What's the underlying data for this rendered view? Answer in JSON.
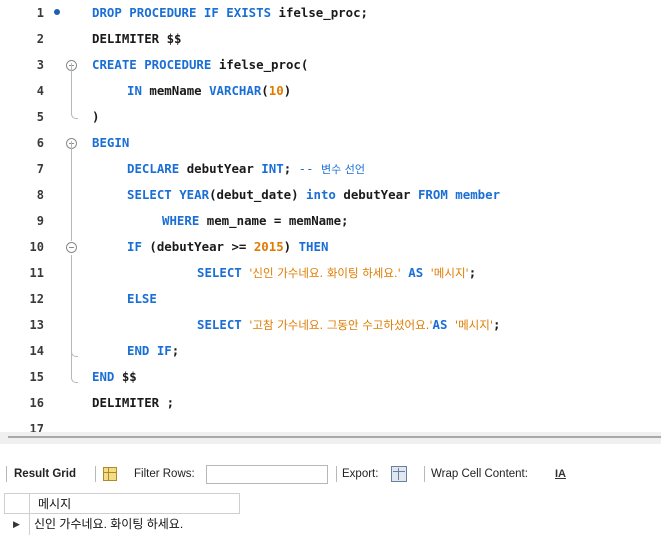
{
  "editor": {
    "lines": [
      {
        "n": "1",
        "tokens": [
          {
            "t": "DROP PROCEDURE IF EXISTS ",
            "c": "kw"
          },
          {
            "t": "ifelse_proc;",
            "c": "id"
          }
        ]
      },
      {
        "n": "2",
        "tokens": [
          {
            "t": "DELIMITER $$",
            "c": "id"
          }
        ]
      },
      {
        "n": "3",
        "tokens": [
          {
            "t": "CREATE PROCEDURE ",
            "c": "kw"
          },
          {
            "t": "ifelse_proc(",
            "c": "id"
          }
        ]
      },
      {
        "n": "4",
        "tokens": [
          {
            "t": "IN ",
            "c": "kw"
          },
          {
            "t": "memName ",
            "c": "id"
          },
          {
            "t": "VARCHAR",
            "c": "kw"
          },
          {
            "t": "(",
            "c": "id"
          },
          {
            "t": "10",
            "c": "num"
          },
          {
            "t": ")",
            "c": "id"
          }
        ]
      },
      {
        "n": "5",
        "tokens": [
          {
            "t": ")",
            "c": "id"
          }
        ]
      },
      {
        "n": "6",
        "tokens": [
          {
            "t": "BEGIN",
            "c": "kw"
          }
        ]
      },
      {
        "n": "7",
        "tokens": [
          {
            "t": "DECLARE ",
            "c": "kw"
          },
          {
            "t": "debutYear ",
            "c": "id"
          },
          {
            "t": "INT",
            "c": "kw"
          },
          {
            "t": "; ",
            "c": "id"
          },
          {
            "t": "-- ",
            "c": "cmt"
          },
          {
            "t": "변수 선언",
            "c": "cmt-ko"
          }
        ]
      },
      {
        "n": "8",
        "tokens": [
          {
            "t": "SELECT ",
            "c": "kw"
          },
          {
            "t": "YEAR",
            "c": "kw"
          },
          {
            "t": "(debut_date) ",
            "c": "id"
          },
          {
            "t": "into ",
            "c": "kw"
          },
          {
            "t": "debutYear ",
            "c": "id"
          },
          {
            "t": "FROM ",
            "c": "kw"
          },
          {
            "t": "member",
            "c": "kw"
          }
        ]
      },
      {
        "n": "9",
        "tokens": [
          {
            "t": "WHERE ",
            "c": "kw"
          },
          {
            "t": "mem_name = memName;",
            "c": "id"
          }
        ]
      },
      {
        "n": "10",
        "tokens": [
          {
            "t": "IF ",
            "c": "kw"
          },
          {
            "t": "(debutYear >= ",
            "c": "id"
          },
          {
            "t": "2015",
            "c": "num"
          },
          {
            "t": ") ",
            "c": "id"
          },
          {
            "t": "THEN",
            "c": "kw"
          }
        ]
      },
      {
        "n": "11",
        "tokens": [
          {
            "t": "SELECT ",
            "c": "kw"
          },
          {
            "t": "'신인 가수네요. 화이팅 하세요.'",
            "c": "str"
          },
          {
            "t": " AS ",
            "c": "kw"
          },
          {
            "t": "'메시지'",
            "c": "str"
          },
          {
            "t": ";",
            "c": "id"
          }
        ]
      },
      {
        "n": "12",
        "tokens": [
          {
            "t": "ELSE",
            "c": "kw"
          }
        ]
      },
      {
        "n": "13",
        "tokens": [
          {
            "t": "SELECT ",
            "c": "kw"
          },
          {
            "t": "'고참 가수네요. 그동안 수고하셨어요.'",
            "c": "str"
          },
          {
            "t": "AS ",
            "c": "kw"
          },
          {
            "t": "'메시지'",
            "c": "str"
          },
          {
            "t": ";",
            "c": "id"
          }
        ]
      },
      {
        "n": "14",
        "tokens": [
          {
            "t": "END IF",
            "c": "kw"
          },
          {
            "t": ";",
            "c": "id"
          }
        ]
      },
      {
        "n": "15",
        "tokens": [
          {
            "t": "END ",
            "c": "kw"
          },
          {
            "t": "$$",
            "c": "id"
          }
        ]
      },
      {
        "n": "16",
        "tokens": [
          {
            "t": "DELIMITER ;",
            "c": "id"
          }
        ]
      },
      {
        "n": "17",
        "tokens": []
      }
    ]
  },
  "toolbar": {
    "result_grid": "Result Grid",
    "filter_rows": "Filter Rows:",
    "filter_value": "",
    "export": "Export:",
    "wrap_cell": "Wrap Cell Content:",
    "wrap_icon": "IA"
  },
  "grid": {
    "columns": [
      "메시지"
    ],
    "rows": [
      [
        "신인 가수네요. 화이팅 하세요."
      ]
    ],
    "row_marker": "▶"
  },
  "colors": {
    "keyword": "#1a6fd6",
    "string": "#e07b00",
    "number": "#e07b00"
  },
  "icons": [
    "current-line-dot-icon",
    "fold-toggle-icon",
    "grid-view-icon",
    "export-icon",
    "wrap-cell-icon",
    "row-pointer-icon"
  ]
}
